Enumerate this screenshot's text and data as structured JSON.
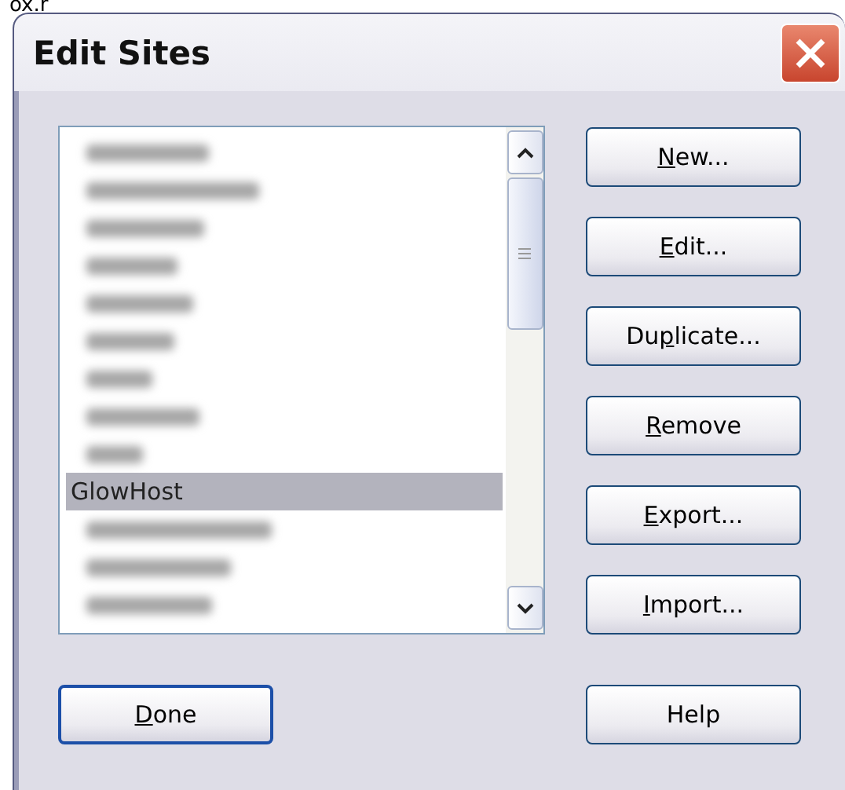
{
  "caption": "ox.r",
  "window": {
    "title": "Edit Sites"
  },
  "site_list": {
    "items": [
      {
        "kind": "blurred",
        "selected": false
      },
      {
        "kind": "blurred",
        "selected": false
      },
      {
        "kind": "blurred",
        "selected": false
      },
      {
        "kind": "blurred",
        "selected": false
      },
      {
        "kind": "blurred",
        "selected": false
      },
      {
        "kind": "blurred",
        "selected": false
      },
      {
        "kind": "blurred",
        "selected": false
      },
      {
        "kind": "blurred",
        "selected": false
      },
      {
        "kind": "blurred",
        "selected": false
      },
      {
        "kind": "text",
        "text": "GlowHost",
        "selected": true
      },
      {
        "kind": "blurred",
        "selected": false
      },
      {
        "kind": "blurred",
        "selected": false
      },
      {
        "kind": "blurred",
        "selected": false
      }
    ]
  },
  "side_buttons": [
    {
      "key": "N",
      "post": "ew..."
    },
    {
      "key": "E",
      "post": "dit..."
    },
    {
      "pre": "Du",
      "key": "p",
      "post": "licate..."
    },
    {
      "key": "R",
      "post": "emove"
    },
    {
      "key": "E",
      "post": "xport..."
    },
    {
      "key": "I",
      "post": "mport..."
    }
  ],
  "bottom_buttons": [
    {
      "key": "D",
      "post": "one",
      "default": true
    },
    {
      "pre": "Help",
      "default": false
    }
  ]
}
